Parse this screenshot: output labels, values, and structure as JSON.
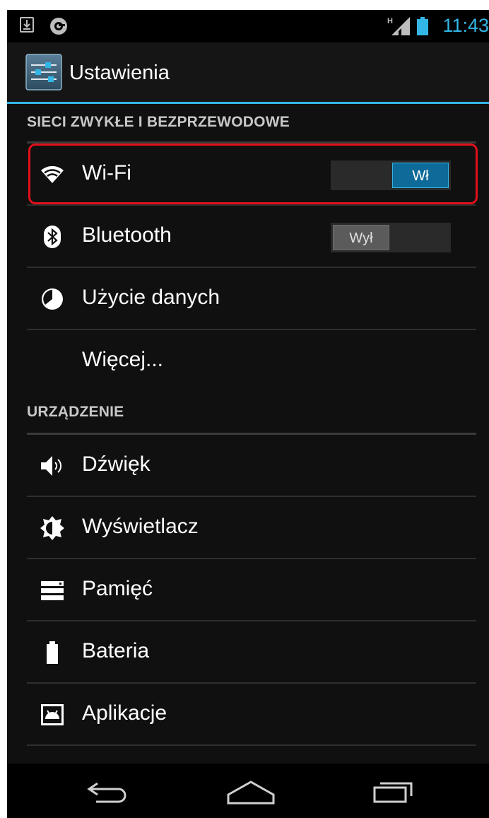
{
  "status_bar": {
    "time": "11:43",
    "network_type": "H",
    "icons": [
      "download-icon",
      "app-notification-icon",
      "signal-icon",
      "battery-icon"
    ],
    "accent_color": "#33b5e5"
  },
  "action_bar": {
    "title": "Ustawienia",
    "icon": "settings-sliders-icon"
  },
  "sections": {
    "wireless": {
      "header": "SIECI ZWYKŁE I BEZPRZEWODOWE",
      "items": [
        {
          "label": "Wi-Fi",
          "icon": "wifi-icon",
          "toggle": "Wł",
          "toggle_state": "on"
        },
        {
          "label": "Bluetooth",
          "icon": "bluetooth-icon",
          "toggle": "Wył",
          "toggle_state": "off"
        },
        {
          "label": "Użycie danych",
          "icon": "data-usage-icon"
        },
        {
          "label": "Więcej..."
        }
      ]
    },
    "device": {
      "header": "URZĄDZENIE",
      "items": [
        {
          "label": "Dźwięk",
          "icon": "sound-icon"
        },
        {
          "label": "Wyświetlacz",
          "icon": "display-icon"
        },
        {
          "label": "Pamięć",
          "icon": "storage-icon"
        },
        {
          "label": "Bateria",
          "icon": "battery-icon"
        },
        {
          "label": "Aplikacje",
          "icon": "apps-icon"
        }
      ]
    }
  },
  "highlight_color": "#e0101a",
  "nav_bar": {
    "buttons": [
      "back-icon",
      "home-icon",
      "recent-apps-icon"
    ]
  }
}
